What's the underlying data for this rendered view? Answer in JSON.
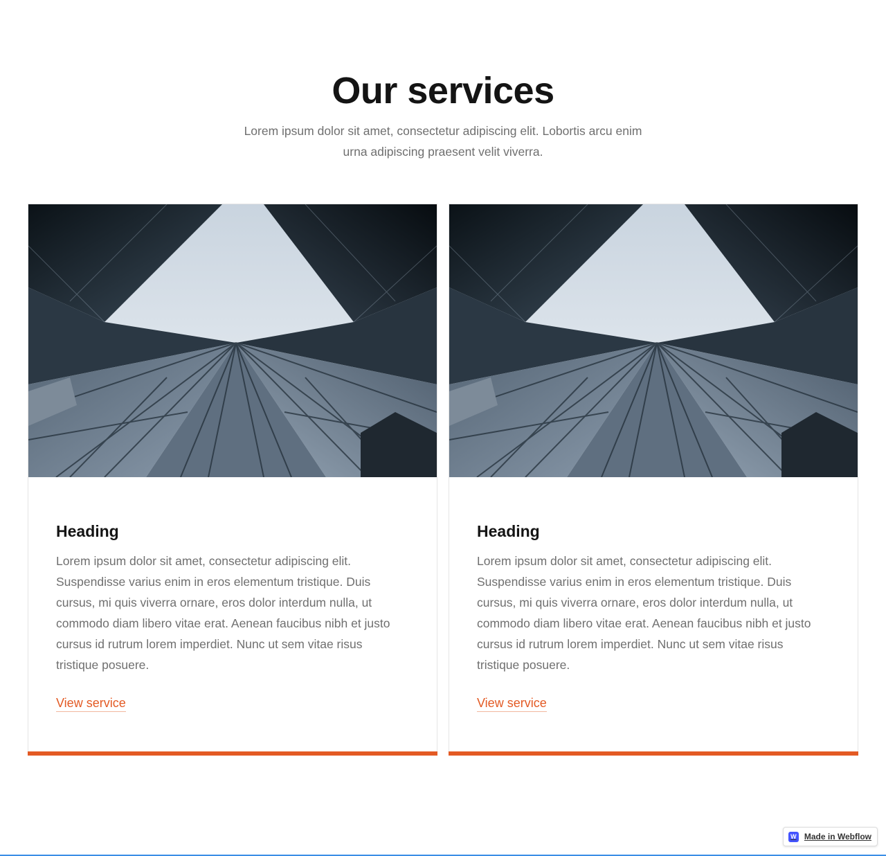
{
  "services": {
    "title": "Our services",
    "subtitle": "Lorem ipsum dolor sit amet, consectetur adipiscing elit. Lobortis arcu enim urna adipiscing praesent velit viverra."
  },
  "cards": [
    {
      "heading": "Heading",
      "text": "Lorem ipsum dolor sit amet, consectetur adipiscing elit. Suspendisse varius enim in eros elementum tristique. Duis cursus, mi quis viverra ornare, eros dolor interdum nulla, ut commodo diam libero vitae erat. Aenean faucibus nibh et justo cursus id rutrum lorem imperdiet. Nunc ut sem vitae risus tristique posuere.",
      "link_label": "View service",
      "image_icon": "skyscraper-photo"
    },
    {
      "heading": "Heading",
      "text": "Lorem ipsum dolor sit amet, consectetur adipiscing elit. Suspendisse varius enim in eros elementum tristique. Duis cursus, mi quis viverra ornare, eros dolor interdum nulla, ut commodo diam libero vitae erat. Aenean faucibus nibh et justo cursus id rutrum lorem imperdiet. Nunc ut sem vitae risus tristique posuere.",
      "link_label": "View service",
      "image_icon": "skyscraper-photo"
    }
  ],
  "badge": {
    "label": "Made in Webflow",
    "icon_letter": "W",
    "icon": "webflow-logo-icon"
  },
  "colors": {
    "accent": "#e35a24",
    "heading": "#141414",
    "body_text": "#6f6f6f",
    "badge_icon": "#4353ff"
  }
}
